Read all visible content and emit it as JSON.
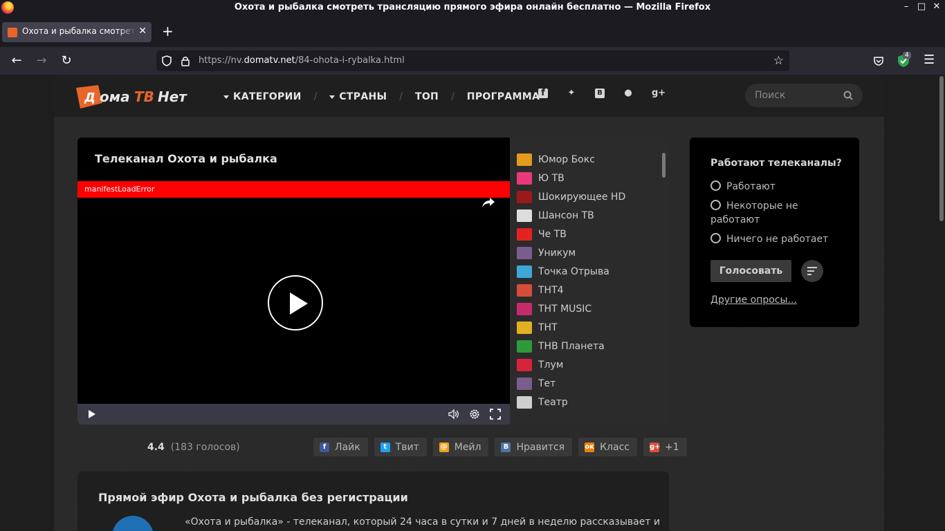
{
  "window": {
    "title": "Охота и рыбалка смотреть трансляцию прямого эфира онлайн бесплатно — Mozilla Firefox"
  },
  "tab": {
    "title": "Охота и рыбалка смотреть трансляцию прямого эфира онлайн бесплатно"
  },
  "url": {
    "prefix": "https://nv.",
    "domain": "domatv.net",
    "path": "/84-ohota-i-rybalka.html"
  },
  "toolbar": {
    "extension_badge": "4"
  },
  "site": {
    "nav": [
      "КАТЕГОРИИ",
      "СТРАНЫ",
      "ТОП",
      "ПРОГРАММА"
    ],
    "social_icons": [
      "facebook-icon",
      "twitter-icon",
      "vk-icon",
      "odnoklassniki-icon",
      "google-plus-icon"
    ],
    "search_placeholder": "Поиск"
  },
  "player": {
    "title": "Телеканал Охота и рыбалка",
    "error": "manifestLoadError"
  },
  "channels": [
    {
      "name": "Юмор Бокс",
      "color": "#e39a1d"
    },
    {
      "name": "Ю ТВ",
      "color": "#e83a7b"
    },
    {
      "name": "Шокирующее HD",
      "color": "#9a1a1a"
    },
    {
      "name": "Шансон ТВ",
      "color": "#dddddd"
    },
    {
      "name": "Че ТВ",
      "color": "#e42222"
    },
    {
      "name": "Уникум",
      "color": "#7b5c8e"
    },
    {
      "name": "Точка Отрыва",
      "color": "#3fa7d6"
    },
    {
      "name": "ТНТ4",
      "color": "#d64d3a"
    },
    {
      "name": "ТНТ MUSIC",
      "color": "#c52b6b"
    },
    {
      "name": "ТНТ",
      "color": "#e0b020"
    },
    {
      "name": "ТНВ Планета",
      "color": "#2e9a3a"
    },
    {
      "name": "Тлум",
      "color": "#d6243a"
    },
    {
      "name": "Тет",
      "color": "#7b5c8e"
    },
    {
      "name": "Театр",
      "color": "#cfcfcf"
    }
  ],
  "rating": {
    "score": "4.4",
    "votes": "(183 голосов)"
  },
  "shares": [
    {
      "label": "Лайк",
      "icon": "f",
      "color": "#3b5998"
    },
    {
      "label": "Твит",
      "icon": "t",
      "color": "#1da1f2"
    },
    {
      "label": "Мейл",
      "icon": "@",
      "color": "#f0a020"
    },
    {
      "label": "Нравится",
      "icon": "В",
      "color": "#4c75a3"
    },
    {
      "label": "Класс",
      "icon": "ок",
      "color": "#ee8208"
    },
    {
      "label": "+1",
      "icon": "g+",
      "color": "#dd4b39"
    }
  ],
  "description": {
    "title": "Прямой эфир Охота и рыбалка без регистрации",
    "text": "«Охота и рыбалка» - телеканал, который 24 часа в сутки и 7 дней в неделю рассказывает и"
  },
  "poll": {
    "question": "Работают телеканалы?",
    "options": [
      "Работают",
      "Некоторые не работают",
      "Ничего не работает"
    ],
    "vote": "Голосовать",
    "more": "Другие опросы..."
  }
}
